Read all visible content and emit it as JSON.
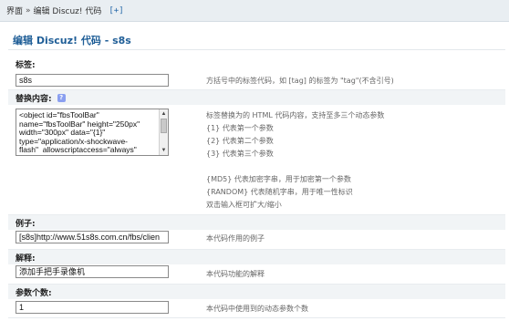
{
  "breadcrumb": {
    "root": "界面",
    "separator": "»",
    "current": "编辑 Discuz! 代码",
    "expand": "[+]"
  },
  "page_title": "编辑 Discuz! 代码 - s8s",
  "tag": {
    "label": "标签:",
    "value": "s8s",
    "hint": "方括号中的标签代码，如 [tag] 的标签为 \"tag\"(不含引号)"
  },
  "replacement": {
    "label": "替换内容:",
    "help_icon": "help-icon",
    "value": "<object id=\"fbsToolBar\"\nname=\"fbsToolBar\" height=\"250px\"\nwidth=\"300px\" data=\"{1}\"\ntype=\"application/x-shockwave-\nflash\"  allowscriptaccess=\"always\"",
    "hints": [
      "标签替换为的 HTML 代码内容，支持至多三个动态参数",
      "{1} 代表第一个参数",
      "{2} 代表第二个参数",
      "{3} 代表第三个参数",
      "",
      "{MD5} 代表加密字串，用于加密第一个参数",
      "{RANDOM} 代表随机字串，用于唯一性标识",
      "双击输入框可扩大/缩小"
    ]
  },
  "example": {
    "label": "例子:",
    "value": "[s8s]http://www.51s8s.com.cn/fbs/clien",
    "hint": "本代码作用的例子"
  },
  "explanation": {
    "label": "解释:",
    "value": "添加手把手录像机",
    "hint": "本代码功能的解释"
  },
  "param_count": {
    "label": "参数个数:",
    "value": "1",
    "hint": "本代码中使用到的动态参数个数"
  }
}
